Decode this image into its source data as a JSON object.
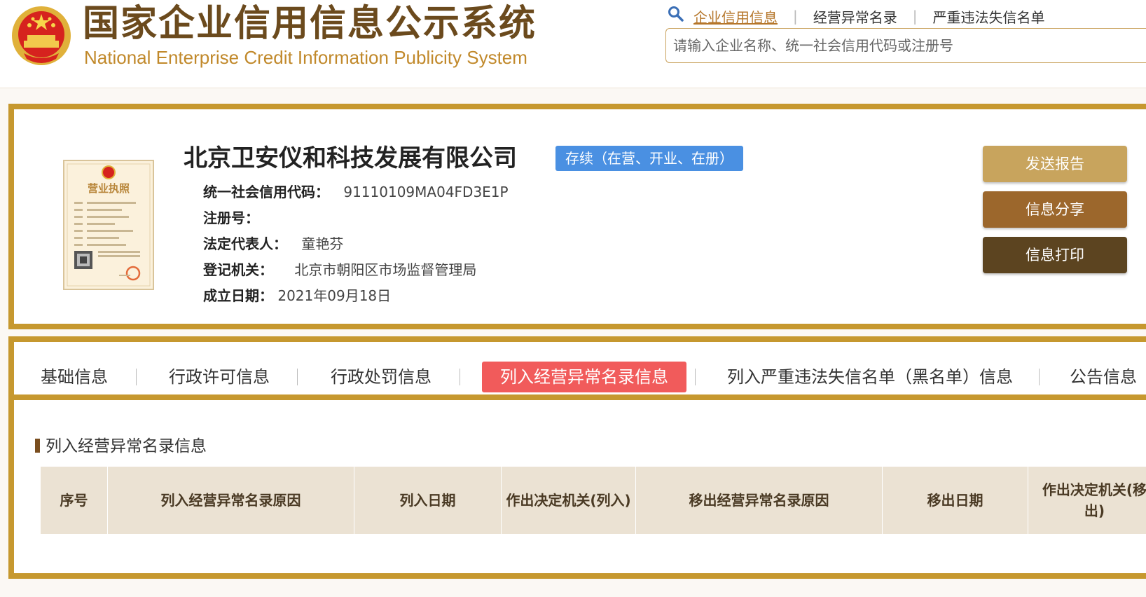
{
  "header": {
    "title_cn": "国家企业信用信息公示系统",
    "title_en": "National Enterprise Credit Information Publicity System",
    "nav_links": [
      {
        "label": "企业信用信息",
        "active": true
      },
      {
        "label": "经营异常名录",
        "active": false
      },
      {
        "label": "严重违法失信名单",
        "active": false
      }
    ],
    "search_placeholder": "请输入企业名称、统一社会信用代码或注册号"
  },
  "license_image": {
    "heading": "营业执照"
  },
  "company": {
    "name": "北京卫安仪和科技发展有限公司",
    "status": "存续（在营、开业、在册）",
    "fields": [
      {
        "label": "统一社会信用代码：",
        "value": "91110109MA04FD3E1P"
      },
      {
        "label": "注册号：",
        "value": ""
      },
      {
        "label": "法定代表人：",
        "value": "童艳芬"
      },
      {
        "label": "登记机关：",
        "value": "北京市朝阳区市场监督管理局"
      },
      {
        "label": "成立日期：",
        "value": "2021年09月18日"
      }
    ]
  },
  "actions": {
    "send_report": "发送报告",
    "share": "信息分享",
    "print": "信息打印"
  },
  "tabs": [
    {
      "label": "基础信息",
      "active": false
    },
    {
      "label": "行政许可信息",
      "active": false
    },
    {
      "label": "行政处罚信息",
      "active": false
    },
    {
      "label": "列入经营异常名录信息",
      "active": true
    },
    {
      "label": "列入严重违法失信名单（黑名单）信息",
      "active": false
    },
    {
      "label": "公告信息",
      "active": false
    }
  ],
  "section": {
    "title": "列入经营异常名录信息",
    "columns": [
      "序号",
      "列入经营异常名录原因",
      "列入日期",
      "作出决定机关(列入)",
      "移出经营异常名录原因",
      "移出日期",
      "作出决定机关(移出)"
    ],
    "rows": []
  },
  "colors": {
    "gold_border": "#c6982f",
    "brown_title": "#6b4a1d",
    "status_blue": "#4a90e2",
    "active_tab": "#f15b5b",
    "btn_send": "#c8a45d",
    "btn_share": "#9c672c",
    "btn_print": "#5c4420"
  }
}
